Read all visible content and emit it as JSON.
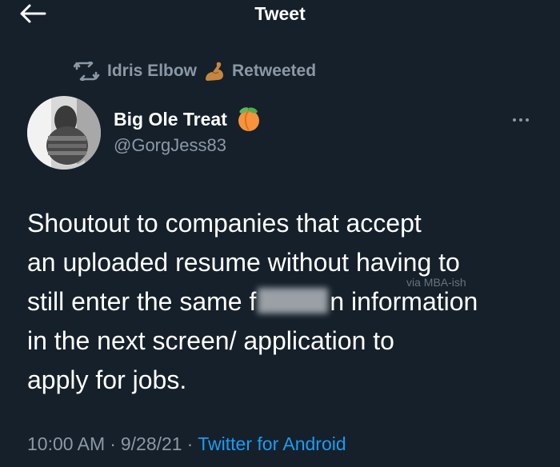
{
  "header": {
    "title": "Tweet",
    "back_icon": "arrow-left-icon"
  },
  "retweet": {
    "icon": "retweet-icon",
    "user_name": "Idris Elbow",
    "emoji": "flexed-biceps-emoji",
    "label": "Retweeted"
  },
  "author": {
    "display_name": "Big Ole Treat",
    "emoji": "peach-emoji",
    "handle": "@GorgJess83"
  },
  "more_icon": "ellipsis-icon",
  "tweet": {
    "line1": "Shoutout to companies that accept",
    "line2": "an uploaded resume without having to",
    "line3_before": "still enter the same f",
    "line3_after": "n information",
    "line4": "in the next screen/ application to",
    "line5": "apply for jobs."
  },
  "watermark": "via MBA-ish",
  "meta": {
    "time": "10:00 AM",
    "separator": "·",
    "date": "9/28/21",
    "source": "Twitter for Android"
  },
  "colors": {
    "background": "#15202b",
    "secondary_text": "#8b98a5",
    "link": "#1d9bf0"
  }
}
